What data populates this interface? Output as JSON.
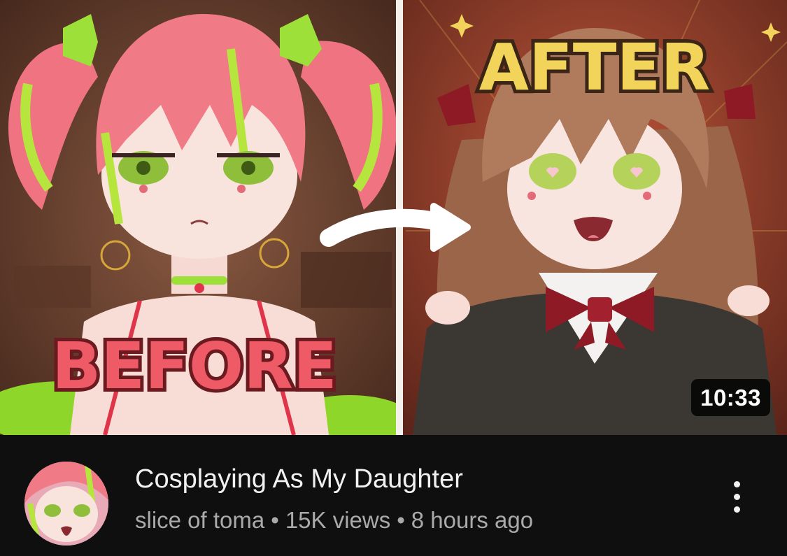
{
  "video": {
    "thumbnail": {
      "before_text": "BEFORE",
      "after_text": "AFTER",
      "duration": "10:33"
    },
    "title": "Cosplaying As My Daughter",
    "channel": "slice of toma",
    "views": "15K views",
    "age": "8 hours ago",
    "separator": "•",
    "colors": {
      "before_bg": "#6b3a2a",
      "after_bg": "#7a2f20",
      "before_text_fill": "#ee5b67",
      "after_text_fill": "#f3d45a",
      "pink_hair": "#f07b87",
      "lime_accent": "#a8e23a",
      "brown_hair": "#b07a5c",
      "bow_red": "#8e1a26"
    }
  },
  "icons": {
    "more": "more-vert-icon",
    "arrow": "curved-arrow-icon"
  }
}
